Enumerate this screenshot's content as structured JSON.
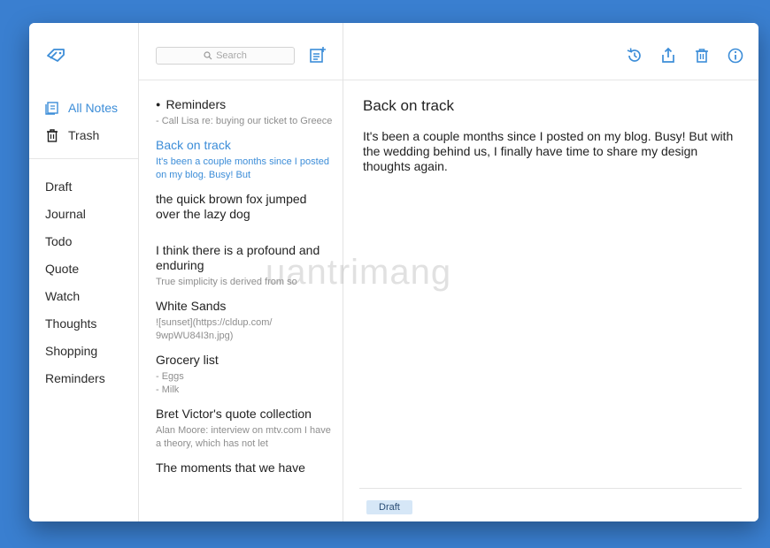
{
  "window": {
    "traffic_lights": {
      "red": "#fc5f57",
      "yellow": "#fdbc2e",
      "green": "#28c840"
    },
    "accent_color": "#3c8dd8"
  },
  "sidebar": {
    "logo_icon": "tag-icon",
    "primary": [
      {
        "label": "All Notes",
        "icon": "notes-icon",
        "active": true
      },
      {
        "label": "Trash",
        "icon": "trash-icon",
        "active": false
      }
    ],
    "tags": [
      "Draft",
      "Journal",
      "Todo",
      "Quote",
      "Watch",
      "Thoughts",
      "Shopping",
      "Reminders"
    ]
  },
  "note_list": {
    "search_placeholder": "Search",
    "notes": [
      {
        "title": "Reminders",
        "preview": "- Call Lisa re: buying our ticket to Greece",
        "bullet": "●"
      },
      {
        "title": "Back on track",
        "preview": "It's been a couple months since I posted on my blog. Busy! But",
        "selected": true
      },
      {
        "title": "the quick brown fox jumped over the lazy dog",
        "preview": ""
      },
      {
        "title": "I think there is a profound and enduring",
        "preview": "True simplicity is derived from so"
      },
      {
        "title": "White Sands",
        "preview": "![sunset](https://cldup.com/ 9wpWU84I3n.jpg)"
      },
      {
        "title": "Grocery list",
        "preview": "- Eggs\n- Milk"
      },
      {
        "title": "Bret Victor's quote collection",
        "preview": "Alan Moore: interview on mtv.com I have a theory, which has not let"
      },
      {
        "title": "The moments that we have",
        "preview": ""
      }
    ]
  },
  "editor": {
    "toolbar": [
      "history-icon",
      "share-icon",
      "trash-icon",
      "info-icon"
    ],
    "title": "Back on track",
    "body": "It's been a couple months since I posted on my blog. Busy! But with the wedding behind us, I finally have time to share my design thoughts again.",
    "tag": "Draft"
  },
  "watermark": "uantrimang"
}
